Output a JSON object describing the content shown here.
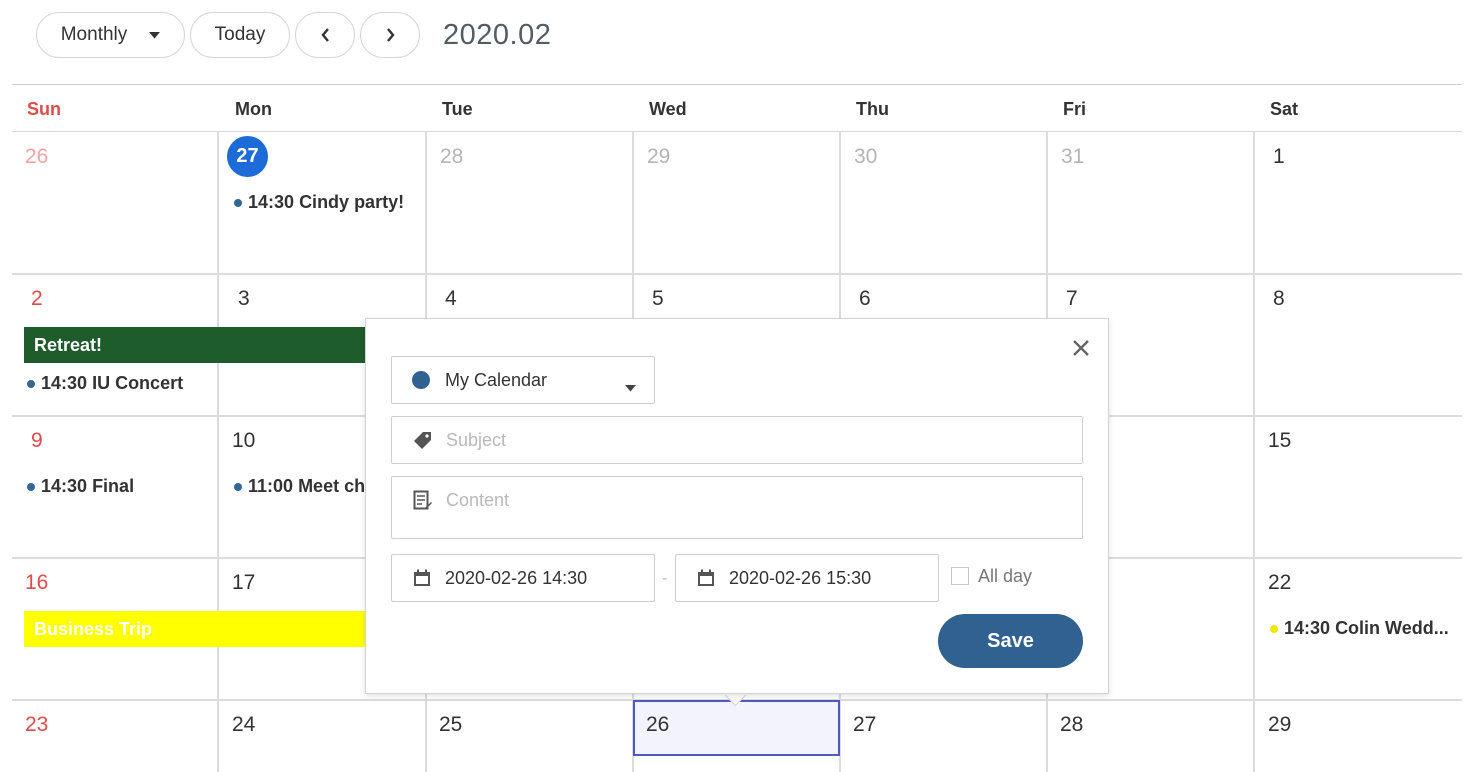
{
  "toolbar": {
    "view_label": "Monthly",
    "today_label": "Today",
    "current_range": "2020.02"
  },
  "weekdays": [
    "Sun",
    "Mon",
    "Tue",
    "Wed",
    "Thu",
    "Fri",
    "Sat"
  ],
  "weeks": [
    [
      "26",
      "27",
      "28",
      "29",
      "30",
      "31",
      "1"
    ],
    [
      "2",
      "3",
      "4",
      "5",
      "6",
      "7",
      "8"
    ],
    [
      "9",
      "10",
      "",
      "",
      "",
      "",
      "15"
    ],
    [
      "16",
      "17",
      "",
      "",
      "",
      "",
      "22"
    ],
    [
      "23",
      "24",
      "25",
      "26",
      "27",
      "28",
      "29"
    ]
  ],
  "events": {
    "cindy": {
      "time": "14:30",
      "title": "Cindy party!",
      "color": "#336699"
    },
    "iu": {
      "time": "14:30",
      "title": "IU Concert",
      "color": "#336699"
    },
    "final": {
      "time": "14:30",
      "title": "Final",
      "color": "#336699"
    },
    "meet": {
      "time": "11:00",
      "title": "Meet ch",
      "color": "#336699"
    },
    "colin": {
      "time": "14:30",
      "title": "Colin Wedd...",
      "color": "#f5e600"
    }
  },
  "allday_events": {
    "retreat": {
      "title": "Retreat!",
      "color": "#1f5c2b"
    },
    "business": {
      "title": "Business Trip",
      "color": "#ffff00"
    }
  },
  "popup": {
    "calendar_name": "My Calendar",
    "calendar_color": "#306191",
    "subject_placeholder": "Subject",
    "content_placeholder": "Content",
    "start": "2020-02-26 14:30",
    "end": "2020-02-26 15:30",
    "allday_label": "All day",
    "dash": "-",
    "save_label": "Save"
  },
  "colors": {
    "today": "#1c6bd8",
    "sunday": "#e04a4a",
    "save": "#306191",
    "selected_border": "#4e5bbd"
  }
}
